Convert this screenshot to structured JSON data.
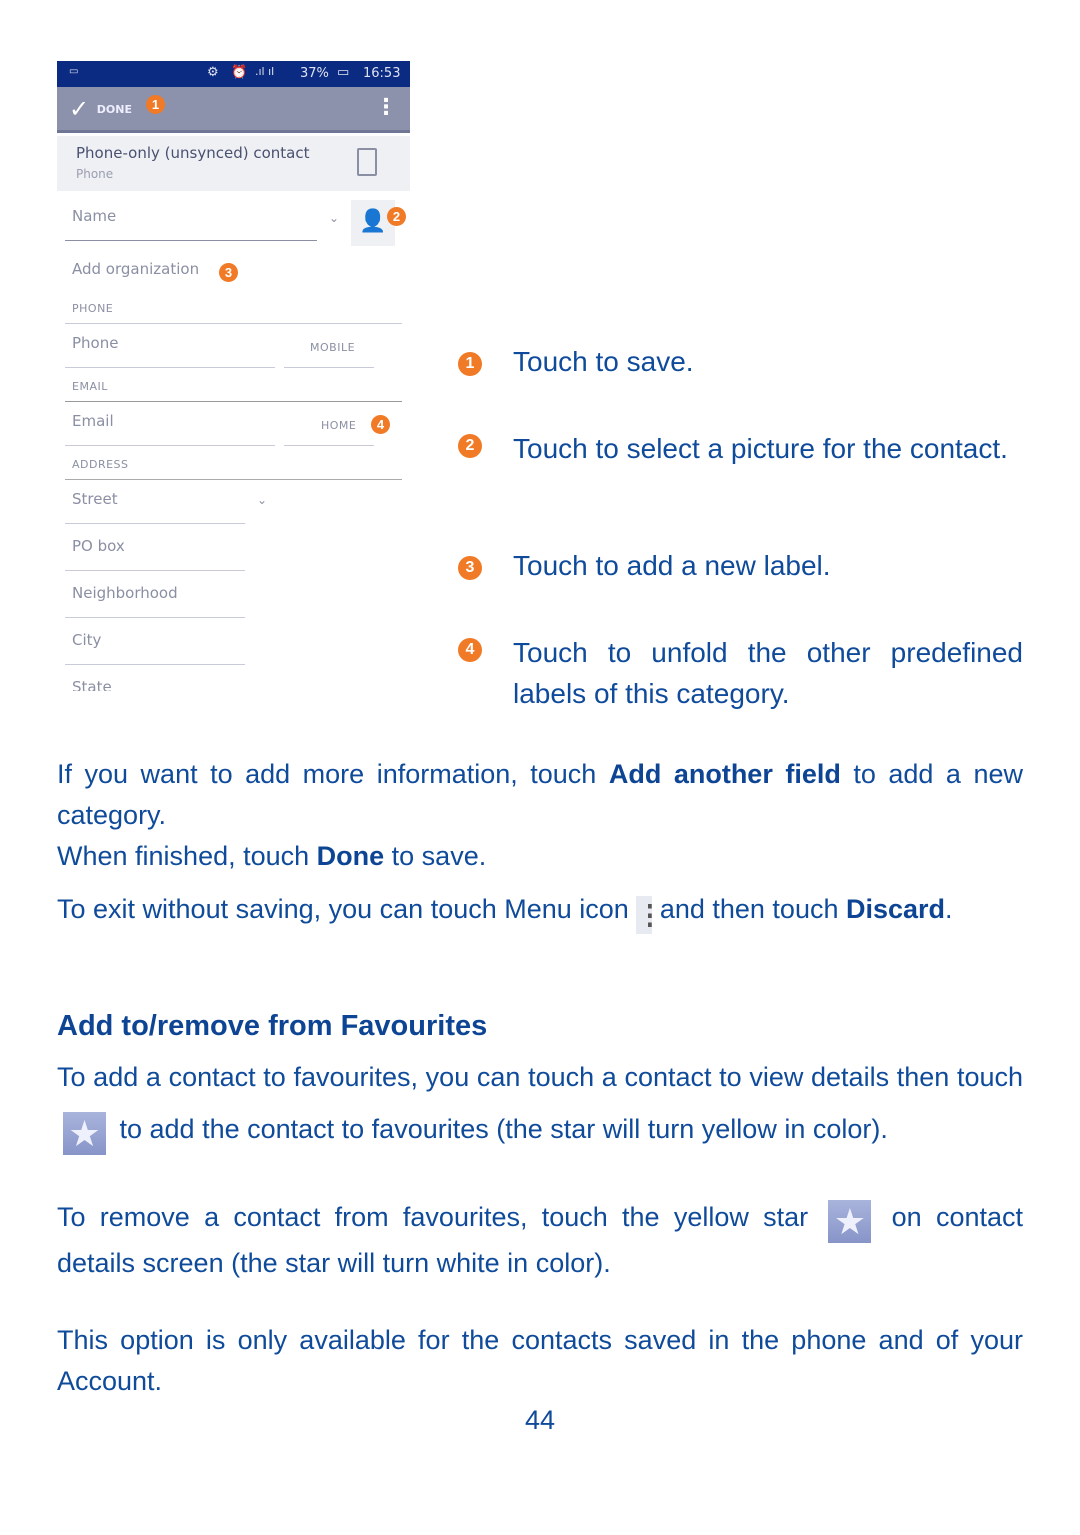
{
  "phone": {
    "status": {
      "battery": "37%",
      "time": "16:53"
    },
    "toolbar": {
      "done_label": "DONE"
    },
    "account": {
      "title": "Phone-only (unsynced) contact",
      "subtitle": "Phone"
    },
    "name_placeholder": "Name",
    "add_organization": "Add organization",
    "sections": {
      "phone": "PHONE",
      "email": "EMAIL",
      "address": "ADDRESS"
    },
    "phone_field": "Phone",
    "phone_type": "MOBILE",
    "email_field": "Email",
    "email_type": "HOME",
    "address_fields": [
      "Street",
      "PO box",
      "Neighborhood",
      "City",
      "State"
    ],
    "badges": [
      "1",
      "2",
      "3",
      "4"
    ]
  },
  "callouts": [
    {
      "num": "1",
      "text": "Touch to save."
    },
    {
      "num": "2",
      "text": "Touch to select a picture for the contact."
    },
    {
      "num": "3",
      "text": "Touch to add a new label."
    },
    {
      "num": "4",
      "text": "Touch to unfold the other predefined labels of this category."
    }
  ],
  "body": {
    "p1_a": "If you want to add more information, touch ",
    "p1_b": "Add another field",
    "p1_c": " to add a new category.",
    "p2_a": "When finished, touch ",
    "p2_b": "Done",
    "p2_c": " to save.",
    "p3_a": "To exit without saving, you can touch Menu icon ",
    "p3_b": " and then touch ",
    "p3_c": "Discard",
    "p3_d": ".",
    "heading": "Add to/remove from Favourites",
    "p4_a": "To add a contact to favourites, you can touch a contact to view details then touch ",
    "p4_b": " to add the contact to favourites (the star will turn yellow in color).",
    "p5_a": "To remove a contact from favourites, touch the yellow star ",
    "p5_b": " on contact details screen (the star will turn white in color).",
    "p6": "This option is only available for the contacts saved in the phone and of your Account."
  },
  "page_number": "44",
  "colors": {
    "text": "#0f4b9a",
    "badge": "#f07a26",
    "status_bar": "#0b2a82",
    "toolbar": "#8c92ab"
  }
}
